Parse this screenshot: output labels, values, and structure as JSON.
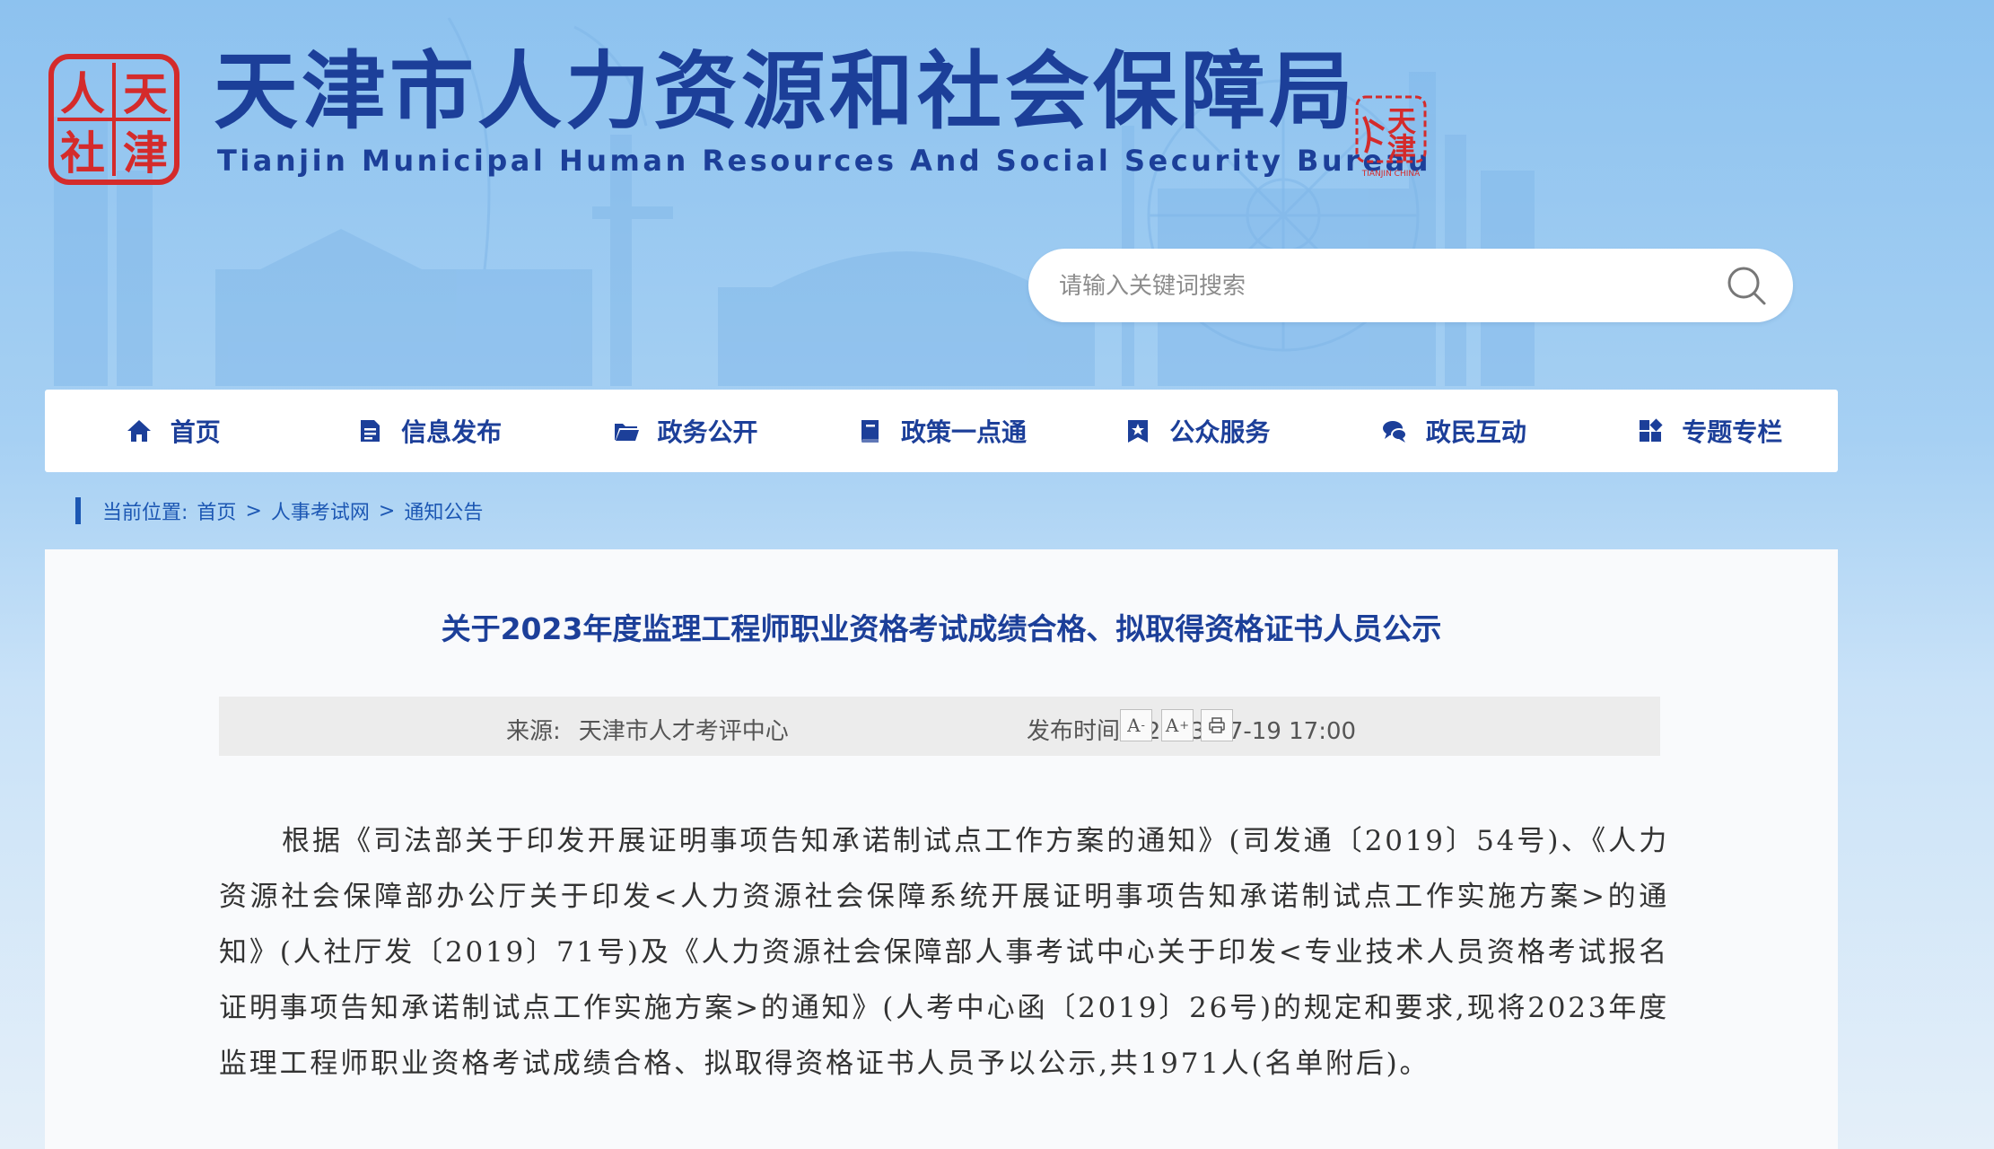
{
  "header": {
    "logo_text": "人天社津",
    "title": "天津市人力资源和社会保障局",
    "subtitle": "Tianjin Municipal Human Resources And Social Security Bureau",
    "seal_text": "天津",
    "seal_caption": "TIANJIN CHINA"
  },
  "search": {
    "placeholder": "请输入关键词搜索"
  },
  "nav": {
    "items": [
      {
        "label": "首页",
        "icon": "home-icon"
      },
      {
        "label": "信息发布",
        "icon": "document-icon"
      },
      {
        "label": "政务公开",
        "icon": "folder-icon"
      },
      {
        "label": "政策一点通",
        "icon": "book-icon"
      },
      {
        "label": "公众服务",
        "icon": "star-badge-icon"
      },
      {
        "label": "政民互动",
        "icon": "chat-icon"
      },
      {
        "label": "专题专栏",
        "icon": "grid-icon"
      }
    ]
  },
  "breadcrumb": {
    "lead": "当前位置:",
    "items": [
      "首页",
      "人事考试网",
      "通知公告"
    ],
    "separator": ">"
  },
  "article": {
    "title": "关于2023年度监理工程师职业资格考试成绩合格、拟取得资格证书人员公示",
    "source_label": "来源:",
    "source": "天津市人才考评中心",
    "time_label": "发布时间:",
    "time": "2023-07-19 17:00",
    "font_decrease": "A",
    "font_decrease_mark": "-",
    "font_increase": "A",
    "font_increase_mark": "+",
    "body": "根据《司法部关于印发开展证明事项告知承诺制试点工作方案的通知》(司发通〔2019〕54号)、《人力资源社会保障部办公厅关于印发<人力资源社会保障系统开展证明事项告知承诺制试点工作实施方案>的通知》(人社厅发〔2019〕71号)及《人力资源社会保障部人事考试中心关于印发<专业技术人员资格考试报名证明事项告知承诺制试点工作实施方案>的通知》(人考中心函〔2019〕26号)的规定和要求,现将2023年度监理工程师职业资格考试成绩合格、拟取得资格证书人员予以公示,共1971人(名单附后)。"
  },
  "colors": {
    "brand": "#1c3f99",
    "link": "#1c57b3",
    "seal_red": "#d42b2b"
  }
}
